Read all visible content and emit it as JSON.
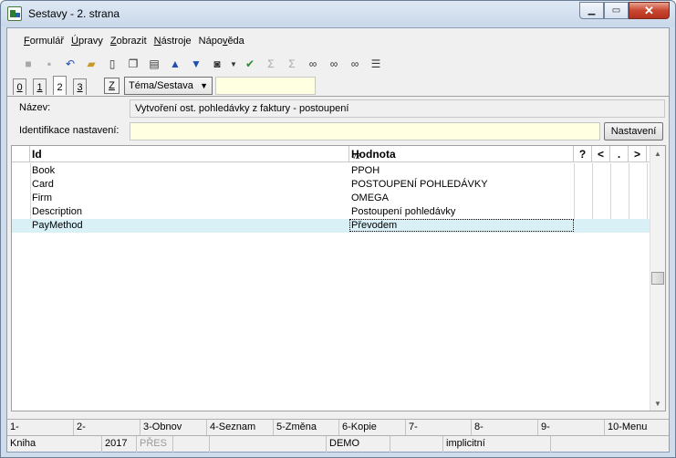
{
  "window": {
    "title": "Sestavy - 2. strana"
  },
  "menu": {
    "items": [
      {
        "label": "Formulář",
        "key": "F",
        "rest": "ormulář"
      },
      {
        "label": "Úpravy",
        "key": "Ú",
        "rest": "pravy"
      },
      {
        "label": "Zobrazit",
        "key": "Z",
        "rest": "obrazit"
      },
      {
        "label": "Nástroje",
        "key": "N",
        "rest": "ástroje"
      },
      {
        "label": "Nápověda",
        "pre": "Nápo",
        "key": "v",
        "rest": "ěda"
      }
    ]
  },
  "toolbar": {
    "icons": [
      "save-icon",
      "save-as-icon",
      "undo-icon",
      "open-folder-icon",
      "new-document-icon",
      "copy-icon",
      "book-icon",
      "arrow-up-icon",
      "arrow-down-icon",
      "camera-icon",
      "filter-icon",
      "sum-icon",
      "sum-clear-icon",
      "binoculars-icon",
      "find-next-icon",
      "find-replace-icon",
      "list-icon"
    ]
  },
  "tabs": {
    "items": [
      "0",
      "1",
      "2",
      "3"
    ],
    "active": "2",
    "z_label": "Z",
    "combo_label": "Téma/Sestava"
  },
  "form": {
    "name_label": "Název:",
    "name_value": "Vytvoření ost. pohledávky z faktury - postoupení",
    "ident_label": "Identifikace nastavení:",
    "ident_value": "",
    "button_label": "Nastavení"
  },
  "grid": {
    "headers": {
      "id": "Id",
      "value": "Hodnota",
      "q": "?",
      "lt": "<",
      "dot": ".",
      "gt": ">",
      "sort_mark": "/2"
    },
    "rows": [
      {
        "id": "Book",
        "value": "PPOH"
      },
      {
        "id": "Card",
        "value": "POSTOUPENÍ POHLEDÁVKY"
      },
      {
        "id": "Firm",
        "value": "OMEGA"
      },
      {
        "id": "Description",
        "value": "Postoupení pohledávky"
      },
      {
        "id": "PayMethod",
        "value": "Převodem"
      }
    ],
    "selected_row": 4
  },
  "fkeys": [
    "1-",
    "2-",
    "3-Obnov",
    "4-Seznam",
    "5-Změna",
    "6-Kopie",
    "7-",
    "8-",
    "9-",
    "10-Menu"
  ],
  "status": {
    "module": "Kniha",
    "year": "2017",
    "mode": "PŘES",
    "s4": "",
    "s5": "",
    "db": "DEMO",
    "s7": "",
    "setting": "implicitní",
    "s9": ""
  }
}
